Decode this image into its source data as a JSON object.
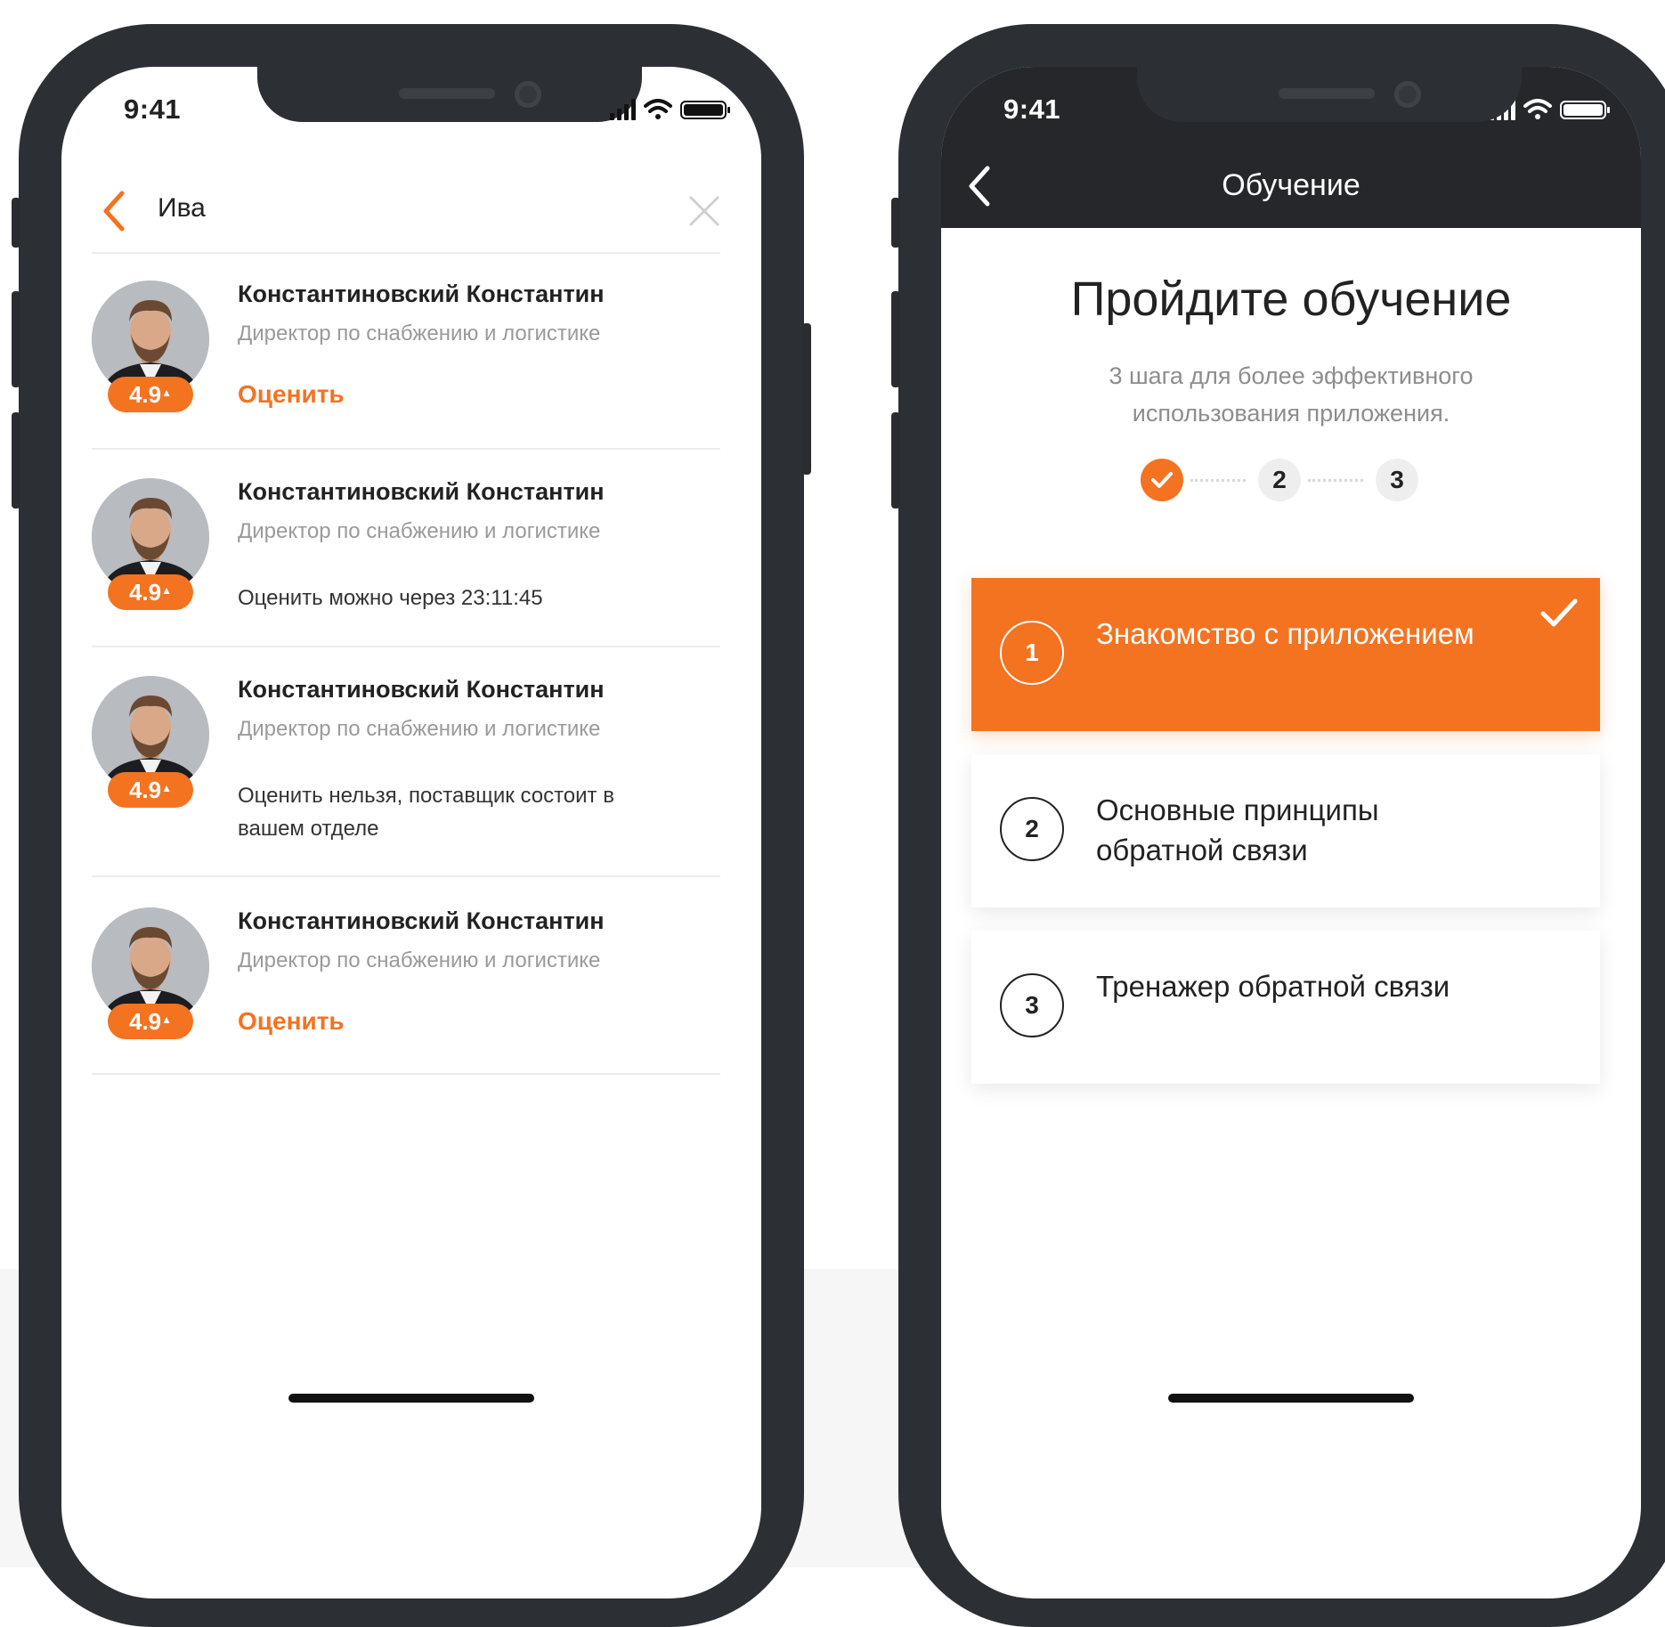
{
  "left_phone": {
    "status_time": "9:41",
    "search": {
      "value": "Ива"
    },
    "contacts": [
      {
        "name": "Константиновский Константин",
        "role": "Директор по снабжению и логистике",
        "rating": "4.9",
        "action": "Оценить"
      },
      {
        "name": "Константиновский Константин",
        "role": "Директор по снабжению и логистике",
        "rating": "4.9",
        "note": "Оценить можно через 23:11:45"
      },
      {
        "name": "Константиновский Константин",
        "role": "Директор по снабжению и логистике",
        "rating": "4.9",
        "note": "Оценить нельзя, поставщик состоит в вашем отделе"
      },
      {
        "name": "Константиновский Константин",
        "role": "Директор по снабжению и логистике",
        "rating": "4.9",
        "action": "Оценить"
      }
    ]
  },
  "right_phone": {
    "status_time": "9:41",
    "header_title": "Обучение",
    "hero_title": "Пройдите обучение",
    "hero_subtitle": "3 шага для более эффективного использования приложения.",
    "stepper": {
      "steps": [
        "1",
        "2",
        "3"
      ],
      "completed": 1
    },
    "steps": [
      {
        "number": "1",
        "label": "Знакомство с приложением",
        "completed": true
      },
      {
        "number": "2",
        "label": "Основные принципы обратной связи",
        "completed": false
      },
      {
        "number": "3",
        "label": "Тренажер обратной связи",
        "completed": false
      }
    ]
  },
  "colors": {
    "accent": "#f37321",
    "dark_header": "#25272b",
    "frame": "#2c2f33"
  },
  "icons": [
    "back-arrow-icon",
    "close-icon",
    "signal-icon",
    "wifi-icon",
    "battery-icon",
    "check-icon",
    "star-icon"
  ]
}
